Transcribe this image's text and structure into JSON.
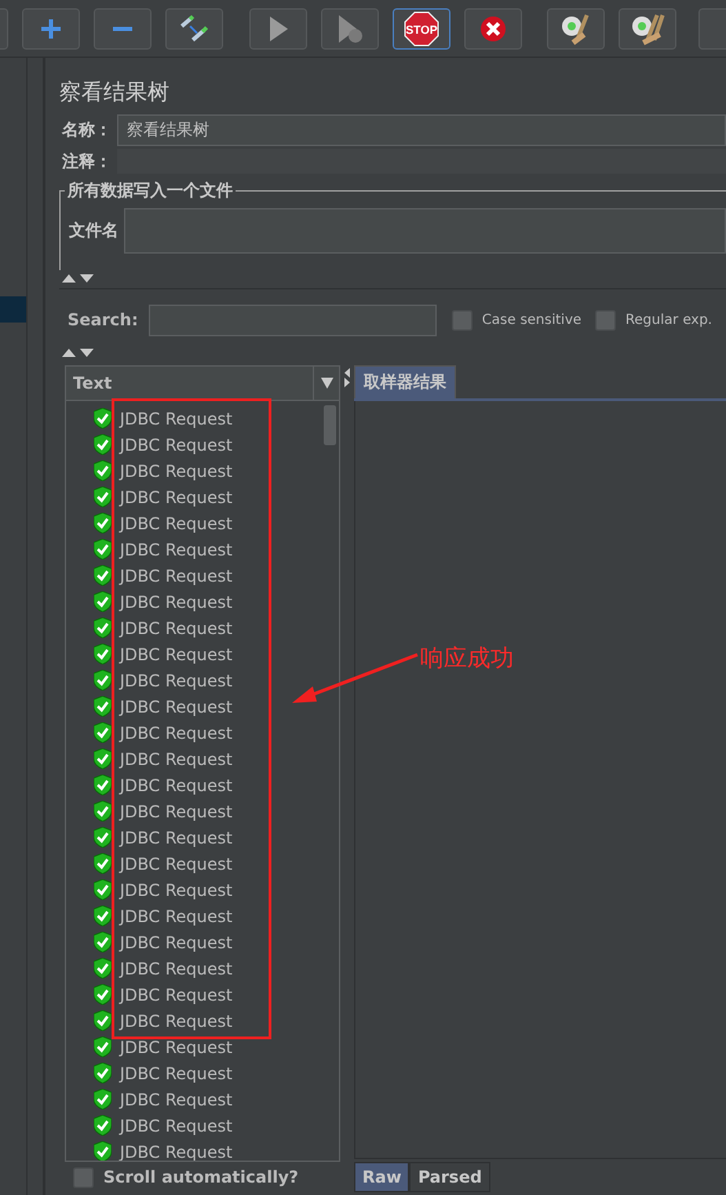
{
  "toolbar": [
    {
      "kind": "edge",
      "focused": false
    },
    {
      "kind": "add",
      "focused": false
    },
    {
      "kind": "remove",
      "focused": false
    },
    {
      "kind": "toggle",
      "focused": false
    },
    {
      "kind": "start",
      "focused": false
    },
    {
      "kind": "start_no_pause",
      "focused": false
    },
    {
      "kind": "stop",
      "focused": true,
      "label": "STOP"
    },
    {
      "kind": "shutdown",
      "focused": false
    },
    {
      "kind": "clear",
      "focused": false
    },
    {
      "kind": "clear_all",
      "focused": false
    },
    {
      "kind": "edge",
      "focused": false
    }
  ],
  "panel": {
    "title": "察看结果树",
    "name_label": "名称：",
    "name_value": "察看结果树",
    "comment_label": "注释：",
    "file_group": "所有数据写入一个文件",
    "file_label": "文件名"
  },
  "search": {
    "label": "Search:",
    "options": [
      {
        "label": "Case sensitive",
        "checked": false
      },
      {
        "label": "Regular exp.",
        "checked": false
      }
    ]
  },
  "tree": {
    "renderer": "Text",
    "results": [
      {
        "label": "JDBC Request",
        "success": true
      },
      {
        "label": "JDBC Request",
        "success": true
      },
      {
        "label": "JDBC Request",
        "success": true
      },
      {
        "label": "JDBC Request",
        "success": true
      },
      {
        "label": "JDBC Request",
        "success": true
      },
      {
        "label": "JDBC Request",
        "success": true
      },
      {
        "label": "JDBC Request",
        "success": true
      },
      {
        "label": "JDBC Request",
        "success": true
      },
      {
        "label": "JDBC Request",
        "success": true
      },
      {
        "label": "JDBC Request",
        "success": true
      },
      {
        "label": "JDBC Request",
        "success": true
      },
      {
        "label": "JDBC Request",
        "success": true
      },
      {
        "label": "JDBC Request",
        "success": true
      },
      {
        "label": "JDBC Request",
        "success": true
      },
      {
        "label": "JDBC Request",
        "success": true
      },
      {
        "label": "JDBC Request",
        "success": true
      },
      {
        "label": "JDBC Request",
        "success": true
      },
      {
        "label": "JDBC Request",
        "success": true
      },
      {
        "label": "JDBC Request",
        "success": true
      },
      {
        "label": "JDBC Request",
        "success": true
      },
      {
        "label": "JDBC Request",
        "success": true
      },
      {
        "label": "JDBC Request",
        "success": true
      },
      {
        "label": "JDBC Request",
        "success": true
      },
      {
        "label": "JDBC Request",
        "success": true
      },
      {
        "label": "JDBC Request",
        "success": true
      },
      {
        "label": "JDBC Request",
        "success": true
      },
      {
        "label": "JDBC Request",
        "success": true
      },
      {
        "label": "JDBC Request",
        "success": true
      },
      {
        "label": "JDBC Request",
        "success": true
      }
    ],
    "scroll_auto": {
      "label": "Scroll automatically?",
      "checked": false
    }
  },
  "result_tabs": [
    {
      "label": "取样器结果",
      "selected": true
    }
  ],
  "view_tabs": [
    {
      "label": "Raw",
      "selected": true
    },
    {
      "label": "Parsed",
      "selected": false
    }
  ],
  "annotation": {
    "text": "响应成功"
  }
}
